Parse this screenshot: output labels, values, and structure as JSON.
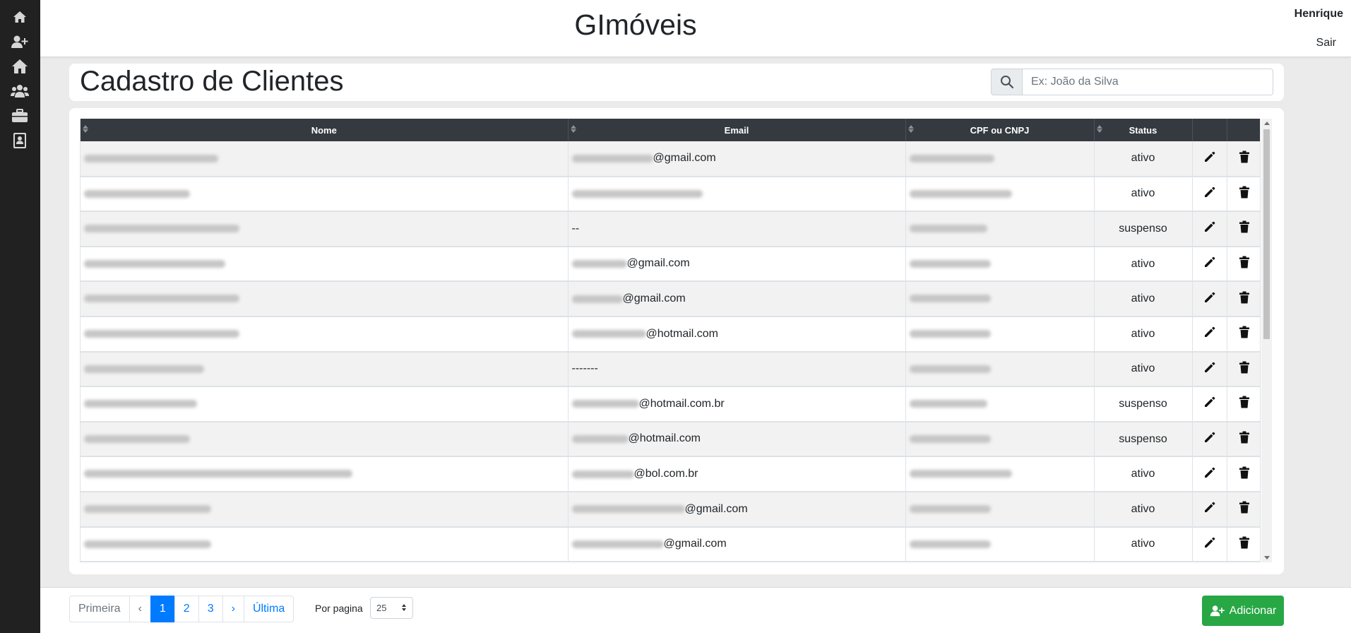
{
  "app": {
    "title": "GImóveis"
  },
  "user": {
    "name": "Henrique",
    "logout_label": "Sair"
  },
  "sidebar": {
    "items": [
      {
        "icon": "home-icon"
      },
      {
        "icon": "user-plus-icon"
      },
      {
        "icon": "house-icon"
      },
      {
        "icon": "users-icon"
      },
      {
        "icon": "briefcase-icon"
      },
      {
        "icon": "contact-card-icon"
      }
    ]
  },
  "page": {
    "title": "Cadastro de Clientes"
  },
  "search": {
    "placeholder": "Ex: João da Silva",
    "value": ""
  },
  "table": {
    "columns": [
      "Nome",
      "Email",
      "CPF ou CNPJ",
      "Status",
      "",
      ""
    ],
    "rows": [
      {
        "email_suffix": "@gmail.com",
        "status": "ativo"
      },
      {
        "email_suffix": "",
        "status": "ativo"
      },
      {
        "email_suffix": "--",
        "status": "suspenso"
      },
      {
        "email_suffix": "@gmail.com",
        "status": "ativo"
      },
      {
        "email_suffix": "@gmail.com",
        "status": "ativo"
      },
      {
        "email_suffix": "@hotmail.com",
        "status": "ativo"
      },
      {
        "email_suffix": "-------",
        "status": "ativo"
      },
      {
        "email_suffix": "@hotmail.com.br",
        "status": "suspenso"
      },
      {
        "email_suffix": "@hotmail.com",
        "status": "suspenso"
      },
      {
        "email_suffix": "@bol.com.br",
        "status": "ativo"
      },
      {
        "email_suffix": "@gmail.com",
        "status": "ativo"
      },
      {
        "email_suffix": "@gmail.com",
        "status": "ativo"
      }
    ]
  },
  "pagination": {
    "first_label": "Primeira",
    "prev_label": "‹",
    "pages": [
      "1",
      "2",
      "3"
    ],
    "active_page": "1",
    "next_label": "›",
    "last_label": "Última",
    "per_page_label": "Por pagina",
    "per_page_value": "25"
  },
  "actions": {
    "add_label": "Adicionar"
  },
  "colors": {
    "sidebar": "#212121",
    "table_header": "#343a40",
    "primary": "#007bff",
    "success": "#28a745"
  }
}
